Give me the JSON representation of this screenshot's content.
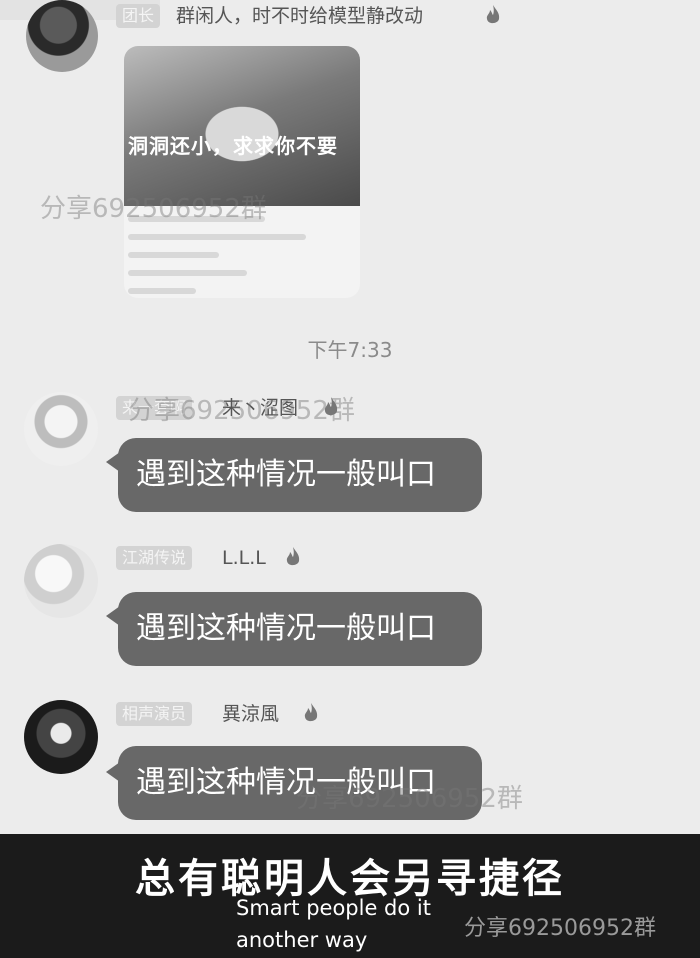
{
  "messages": [
    {
      "role_tag": "团长",
      "name": "群闲人，时不时给模型静改动",
      "image_caption": "洞洞还小，求求你不要"
    },
    {
      "role_tag": "来一套啊",
      "name": "来丶涩图",
      "text": "遇到这种情况一般叫口"
    },
    {
      "role_tag": "江湖传说",
      "name": "L.L.L",
      "text": "遇到这种情况一般叫口"
    },
    {
      "role_tag": "相声演员",
      "name": "異涼風",
      "text": "遇到这种情况一般叫口"
    }
  ],
  "timestamp": "下午7:33",
  "watermarks": [
    "分享692506952群",
    "分享692506952群",
    "分享692506952群",
    "分享692506952群"
  ],
  "caption": {
    "zh": "总有聪明人会另寻捷径",
    "en_line1": "Smart people do it",
    "en_line2": "another way"
  },
  "colors": {
    "bubble": "#686868",
    "background": "#ececec",
    "caption_band": "#1b1b1b"
  }
}
